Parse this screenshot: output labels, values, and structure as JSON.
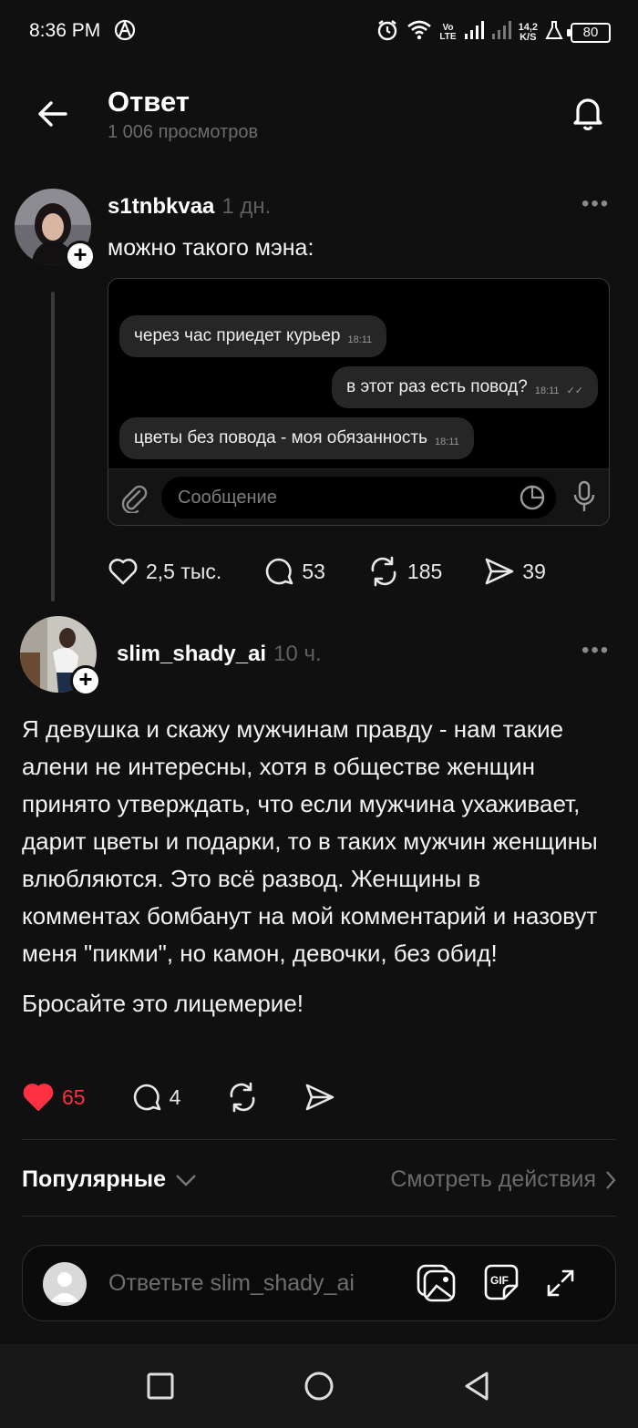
{
  "status_bar": {
    "time": "8:36 PM",
    "volte_top": "Vo",
    "volte_bottom": "LTE",
    "speed_value": "14,2",
    "speed_unit": "K/S",
    "battery": "80"
  },
  "header": {
    "title": "Ответ",
    "subtitle": "1 006 просмотров"
  },
  "post1": {
    "username": "s1tnbkvaa",
    "time_ago": "1 дн.",
    "text": "можно такого мэна:",
    "chat": {
      "messages": [
        {
          "text": "через час приедет курьер",
          "time": "18:11",
          "side": "left"
        },
        {
          "text": "в этот раз есть повод?",
          "time": "18:11",
          "side": "right"
        },
        {
          "text": "цветы без повода - моя обязанность",
          "time": "18:11",
          "side": "left"
        }
      ],
      "input_placeholder": "Сообщение"
    },
    "likes": "2,5 тыс.",
    "comments": "53",
    "reposts": "185",
    "shares": "39"
  },
  "post2": {
    "username": "slim_shady_ai",
    "time_ago": "10 ч.",
    "paragraph1": "Я девушка и скажу мужчинам правду - нам такие алени не интересны, хотя в обществе женщин принято утверждать, что если мужчина ухаживает, дарит цветы и подарки, то в таких мужчин женщины влюбляются. Это всё развод. Женщины в комментах бомбанут на мой комментарий и назовут меня \"пикми\", но камон, девочки, без обид!",
    "paragraph2": "Бросайте это лицемерие!",
    "likes": "65",
    "comments": "4",
    "like_color": "#ff3040"
  },
  "sort": {
    "label": "Популярные",
    "view_actions": "Смотреть действия"
  },
  "reply": {
    "placeholder": "Ответьте slim_shady_ai"
  }
}
